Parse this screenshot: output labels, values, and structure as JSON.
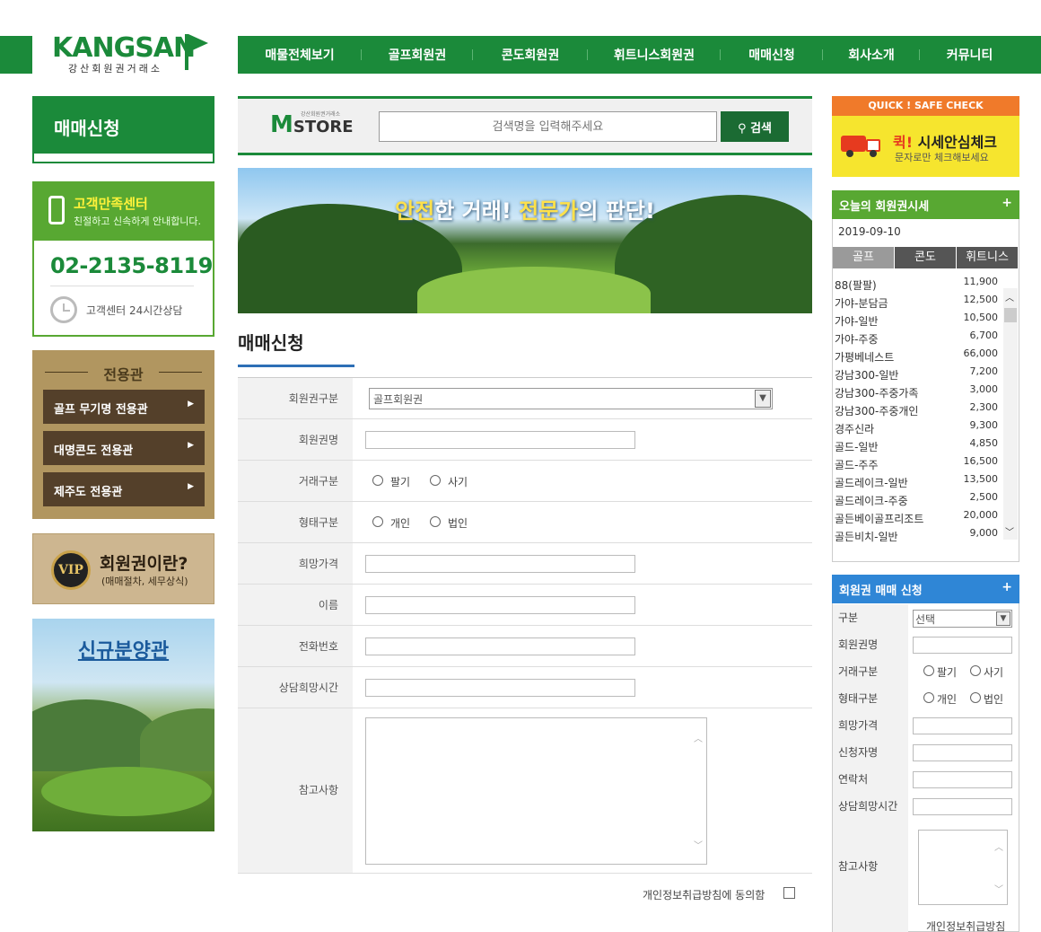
{
  "logo": {
    "main": "KANGSAN",
    "sub": "강산회원권거래소"
  },
  "gnb": [
    "매물전체보기",
    "골프회원권",
    "콘도회원권",
    "휘트니스회원권",
    "매매신청",
    "회사소개",
    "커뮤니티"
  ],
  "lnb": {
    "title": "매매신청"
  },
  "cs": {
    "title": "고객만족센터",
    "sub": "친절하고 신속하게 안내합니다.",
    "phone": "02-2135-8119",
    "hours": "고객센터 24시간상담"
  },
  "exclusive": {
    "title": "전용관",
    "items": [
      "골프 무기명 전용관",
      "대명콘도 전용관",
      "제주도 전용관"
    ]
  },
  "vip": {
    "badge": "VIP",
    "title": "회원권이란?",
    "sub": "(매매절차, 세무상식)"
  },
  "new_sale": {
    "title": "신규분양관"
  },
  "search": {
    "logo": "M",
    "logo2": "STORE",
    "tag": "강산회원권거래소",
    "placeholder": "검색명을 입력해주세요",
    "button": "검색"
  },
  "banner": {
    "hl1": "안전",
    "t1": "한 거래! ",
    "hl2": "전문가",
    "t2": "의 판단!"
  },
  "page": {
    "title": "매매신청"
  },
  "form": {
    "labels": [
      "회원권구분",
      "회원권명",
      "거래구분",
      "형태구분",
      "희망가격",
      "이름",
      "전화번호",
      "상담희망시간",
      "참고사항"
    ],
    "category_value": "골프회원권",
    "trade": [
      "팔기",
      "사기"
    ],
    "type": [
      "개인",
      "법인"
    ],
    "agree": "개인정보취급방침에 동의함"
  },
  "quick": {
    "head": "QUICK ! SAFE CHECK",
    "title_red": "퀵!",
    "title": " 시세안심체크",
    "sub": "문자로만 체크해보세요"
  },
  "rates": {
    "title": "오늘의 회원권시세",
    "date": "2019-09-10",
    "tabs": [
      "골프",
      "콘도",
      "휘트니스"
    ],
    "rows": [
      {
        "name": "88(팔팔)",
        "value": "11,900"
      },
      {
        "name": "가야-분담금",
        "value": "12,500"
      },
      {
        "name": "가야-일반",
        "value": "10,500"
      },
      {
        "name": "가야-주중",
        "value": "6,700"
      },
      {
        "name": "가평베네스트",
        "value": "66,000"
      },
      {
        "name": "강남300-일반",
        "value": "7,200"
      },
      {
        "name": "강남300-주중가족",
        "value": "3,000"
      },
      {
        "name": "강남300-주중개인",
        "value": "2,300"
      },
      {
        "name": "경주신라",
        "value": "9,300"
      },
      {
        "name": "골드-일반",
        "value": "4,850"
      },
      {
        "name": "골드-주주",
        "value": "16,500"
      },
      {
        "name": "골드레이크-일반",
        "value": "13,500"
      },
      {
        "name": "골드레이크-주중",
        "value": "2,500"
      },
      {
        "name": "골든베이골프리조트",
        "value": "20,000"
      },
      {
        "name": "골든비치-일반",
        "value": "9,000"
      }
    ]
  },
  "apply": {
    "title": "회원권 매매 신청",
    "labels": [
      "구분",
      "회원권명",
      "거래구분",
      "형태구분",
      "희망가격",
      "신청자명",
      "연락처",
      "상담희망시간",
      "참고사항"
    ],
    "select_value": "선택",
    "trade": [
      "팔기",
      "사기"
    ],
    "type": [
      "개인",
      "법인"
    ],
    "agree": "개인정보취급방침"
  }
}
